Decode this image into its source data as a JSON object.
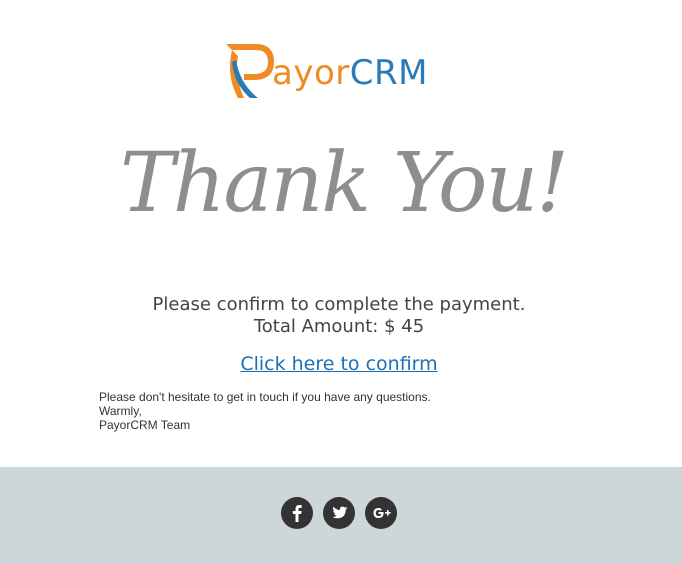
{
  "logo": {
    "brand_part1": "ayor",
    "brand_part2": "CRM",
    "alt": "PayorCRM",
    "colors": {
      "orange": "#f08a24",
      "blue": "#2a7ab8"
    }
  },
  "hero": {
    "text": "Thank You!"
  },
  "message": {
    "line1": "Please confirm to complete the payment.",
    "line2": "Total Amount: $ 45"
  },
  "confirm": {
    "label": "Click here to confirm"
  },
  "note": {
    "line1": "Please don't hesitate to get in touch if you have any questions.",
    "line2": "Warmly,",
    "line3": "PayorCRM Team"
  },
  "footer": {
    "background": "#cdd6d8",
    "icons": [
      "facebook-icon",
      "twitter-icon",
      "google-plus-icon"
    ]
  }
}
